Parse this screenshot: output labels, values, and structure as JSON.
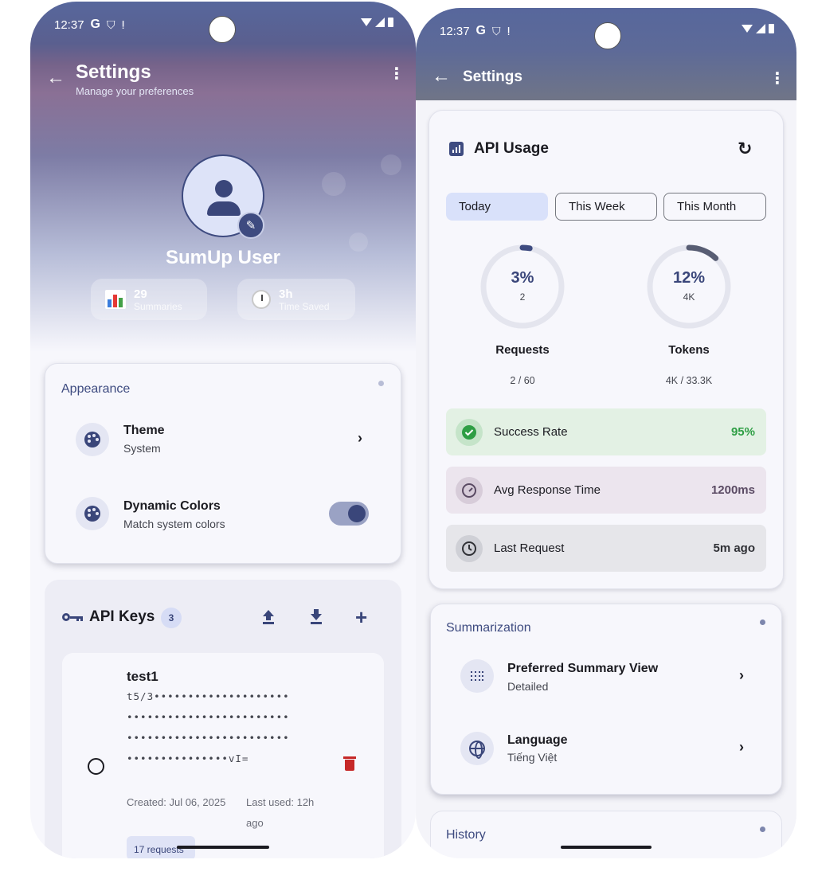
{
  "status": {
    "time": "12:37",
    "g_glyph": "G"
  },
  "left": {
    "header": {
      "title": "Settings",
      "subtitle": "Manage your preferences"
    },
    "profile": {
      "name": "SumUp User",
      "stats": [
        {
          "value": "29",
          "label": "Summaries",
          "icon": "bar-chart-icon"
        },
        {
          "value": "3h",
          "label": "Time Saved",
          "icon": "stopwatch-icon"
        }
      ]
    },
    "appearance": {
      "title": "Appearance",
      "theme_title": "Theme",
      "theme_value": "System",
      "dynamic_title": "Dynamic Colors",
      "dynamic_sub": "Match system colors",
      "dynamic_enabled": true
    },
    "api_keys": {
      "title": "API Keys",
      "count": "3",
      "key": {
        "name": "test1",
        "lines": [
          "t5/3••••••••••••••••••••",
          "••••••••••••••••••••••••",
          "••••••••••••••••••••••••",
          "•••••••••••••••vI="
        ],
        "created": "Created: Jul 06, 2025",
        "last_used_1": "Last used: 12h",
        "last_used_2": "ago",
        "requests": "17 requests"
      }
    }
  },
  "right": {
    "header": {
      "title": "Settings"
    },
    "usage": {
      "title": "API Usage",
      "tabs": [
        "Today",
        "This Week",
        "This Month"
      ],
      "active_tab": "Today",
      "requests": {
        "percent": "3%",
        "fraction": 0.03,
        "sub": "2",
        "label": "Requests",
        "ratio": "2 / 60"
      },
      "tokens": {
        "percent": "12%",
        "fraction": 0.12,
        "sub": "4K",
        "label": "Tokens",
        "ratio": "4K / 33.3K"
      },
      "metrics": [
        {
          "label": "Success Rate",
          "value": "95%",
          "color": "#2e9e44"
        },
        {
          "label": "Avg Response Time",
          "value": "1200ms",
          "color": "#5a4a63"
        },
        {
          "label": "Last Request",
          "value": "5m ago",
          "color": "#303136"
        }
      ]
    },
    "summarization": {
      "title": "Summarization",
      "view_title": "Preferred Summary View",
      "view_value": "Detailed",
      "lang_title": "Language",
      "lang_value": "Tiếng Việt"
    },
    "history": {
      "title": "History"
    }
  }
}
